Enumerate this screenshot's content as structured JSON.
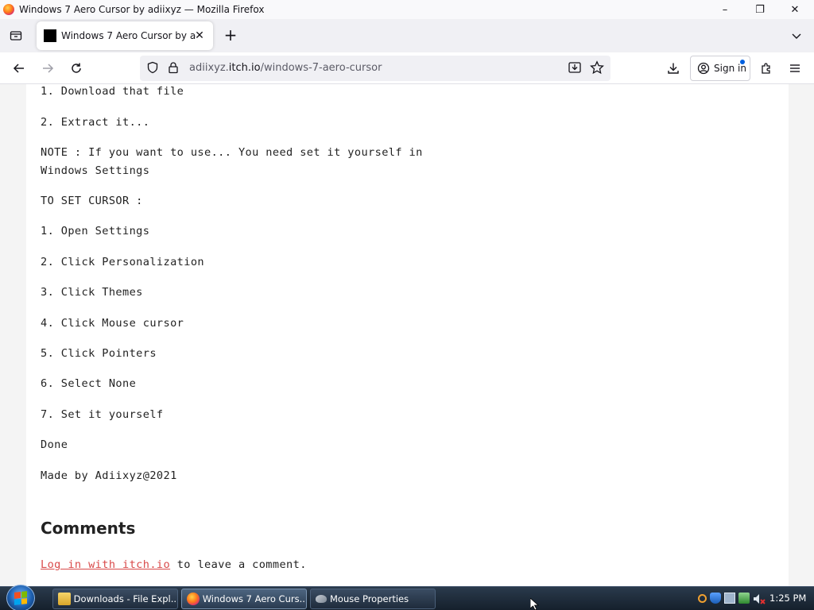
{
  "window": {
    "title": "Windows 7 Aero Cursor by adiixyz — Mozilla Firefox",
    "minimize": "–",
    "restore": "❐",
    "close": "✕"
  },
  "tab": {
    "label": "Windows 7 Aero Cursor by adiixyz",
    "close": "✕",
    "new_tab": "+"
  },
  "urlbar": {
    "url_prefix": "adiixyz.",
    "url_domain": "itch.io",
    "url_path": "/windows-7-aero-cursor"
  },
  "toolbar": {
    "sign_in_label": "Sign in"
  },
  "content": {
    "lines": [
      "1. Download that file",
      "2. Extract it...",
      "NOTE : If you want to use... You need set it yourself in",
      "Windows Settings",
      "TO SET CURSOR :",
      "1. Open Settings",
      "2. Click Personalization",
      "3. Click Themes",
      "4. Click Mouse cursor",
      "5. Click Pointers",
      "6. Select None",
      "7. Set it yourself",
      "Done",
      "Made by Adiixyz@2021"
    ],
    "comments_heading": "Comments",
    "login_link": "Log in with itch.io",
    "login_suffix": " to leave a comment."
  },
  "taskbar": {
    "items": [
      {
        "label": "Downloads - File Expl..."
      },
      {
        "label": "Windows 7 Aero Curs..."
      },
      {
        "label": "Mouse Properties"
      }
    ],
    "clock": "1:25 PM"
  },
  "colors": {
    "link": "#d94a4a",
    "accent": "#0060df"
  }
}
